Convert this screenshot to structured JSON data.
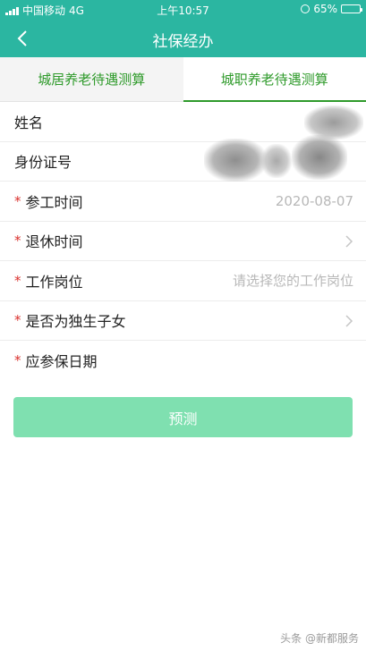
{
  "status_bar": {
    "carrier": "中国移动",
    "network": "4G",
    "time": "上午10:57",
    "battery_text": "65%",
    "battery_level": 0.65
  },
  "navbar": {
    "title": "社保经办",
    "back_icon": "chevron-left-icon"
  },
  "tabs": [
    {
      "label": "城居养老待遇测算",
      "active": false
    },
    {
      "label": "城职养老待遇测算",
      "active": true
    }
  ],
  "form": {
    "name_label": "姓名",
    "id_label": "身份证号",
    "work_start_label": "参工时间",
    "work_start_value": "2020-08-07",
    "retire_label": "退休时间",
    "position_label": "工作岗位",
    "position_placeholder": "请选择您的工作岗位",
    "only_child_label": "是否为独生子女",
    "insure_date_label": "应参保日期",
    "required_mark": "*"
  },
  "submit_label": "预测",
  "watermark": "头条 @新都服务",
  "colors": {
    "header_bg": "#2bb6a1",
    "tab_text": "#2e9a2a",
    "submit_bg": "#7fe0b0",
    "required": "#d9302c"
  }
}
